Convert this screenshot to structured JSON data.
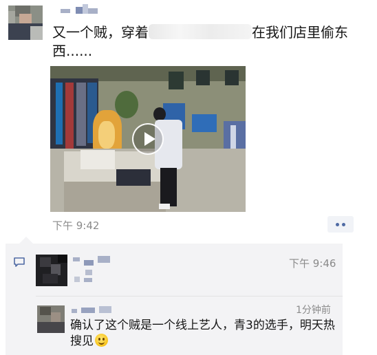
{
  "post": {
    "text_before": "又一个贼，穿着",
    "text_after": "在我们店里偷东西......",
    "time": "下午 9:42"
  },
  "video": {
    "play_icon": "play-icon"
  },
  "more_button": {
    "icon": "more-dots-icon"
  },
  "comments": [
    {
      "time": "下午 9:46",
      "text": ""
    },
    {
      "time": "1分钟前",
      "text": "确认了这个贼是一个线上艺人，青3的选手，明天热搜见"
    }
  ],
  "colors": {
    "link_blue": "#4f6aa3",
    "comment_bg": "#f3f3f5",
    "timestamp": "#8a8a8a"
  }
}
